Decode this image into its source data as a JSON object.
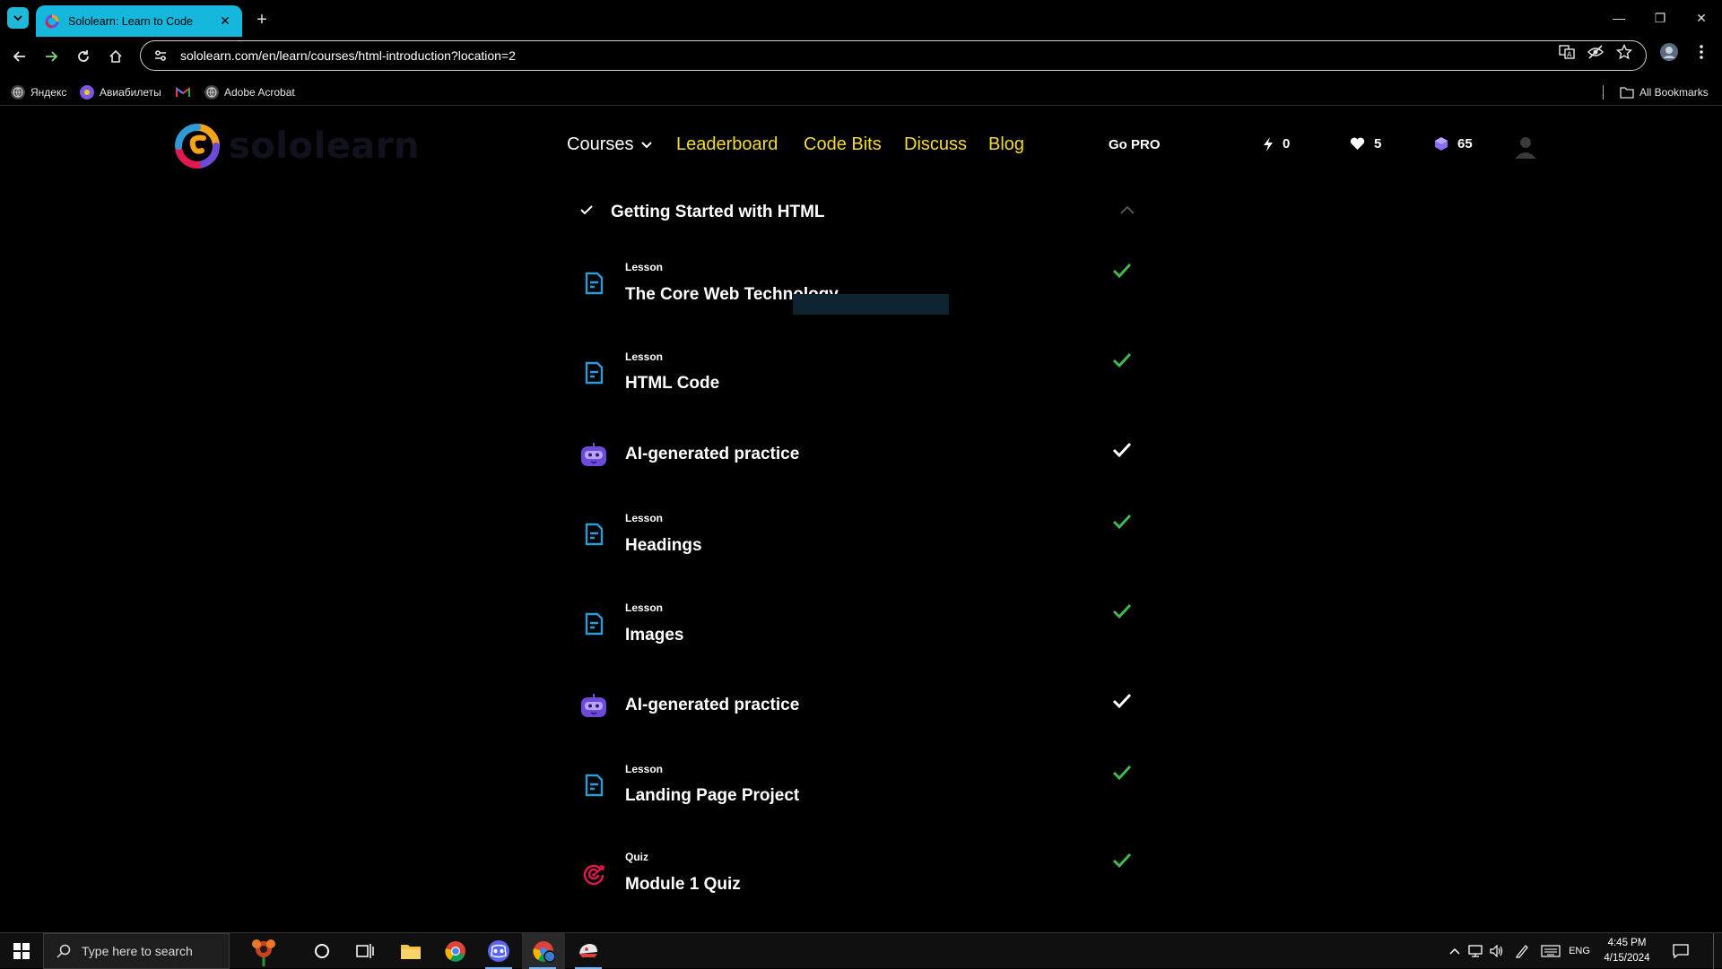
{
  "browser": {
    "tab_title": "Sololearn: Learn to Code",
    "url": "sololearn.com/en/learn/courses/html-introduction?location=2",
    "bookmarks": [
      {
        "label": "Яндекс",
        "icon": "globe-icon"
      },
      {
        "label": "Авиабилеты",
        "icon": "aviasales-icon"
      },
      {
        "label": "",
        "icon": "gmail-icon"
      },
      {
        "label": "Adobe Acrobat",
        "icon": "globe-icon"
      }
    ],
    "all_bookmarks_label": "All Bookmarks"
  },
  "header": {
    "logo_text": "sololearn",
    "nav": {
      "courses": "Courses",
      "leaderboard": "Leaderboard",
      "code_bits": "Code Bits",
      "discuss": "Discuss",
      "blog": "Blog"
    },
    "go_pro": "Go PRO",
    "streak": "0",
    "hearts": "5",
    "gems": "65"
  },
  "module": {
    "title": "Getting Started with HTML",
    "items": [
      {
        "type": "lesson",
        "kind_label": "Lesson",
        "name": "The Core Web Technology",
        "completed": true
      },
      {
        "type": "lesson",
        "kind_label": "Lesson",
        "name": "HTML Code",
        "completed": true
      },
      {
        "type": "practice",
        "kind_label": "",
        "name": "AI-generated practice",
        "completed": true
      },
      {
        "type": "lesson",
        "kind_label": "Lesson",
        "name": "Headings",
        "completed": true
      },
      {
        "type": "lesson",
        "kind_label": "Lesson",
        "name": "Images",
        "completed": true
      },
      {
        "type": "practice",
        "kind_label": "",
        "name": "AI-generated practice",
        "completed": true
      },
      {
        "type": "lesson",
        "kind_label": "Lesson",
        "name": "Landing Page Project",
        "completed": true
      },
      {
        "type": "quiz",
        "kind_label": "Quiz",
        "name": "Module 1 Quiz",
        "completed": true
      }
    ]
  },
  "taskbar": {
    "search_placeholder": "Type here to search",
    "language": "ENG",
    "time": "4:45 PM",
    "date": "4/15/2024"
  },
  "colors": {
    "accent_yellow": "#f5dc30",
    "tab_cyan": "#16b7dc",
    "check_green": "#3fb950",
    "lesson_blue": "#2f9bd6",
    "practice_purple": "#6e4ad9",
    "quiz_red": "#e0194f"
  }
}
